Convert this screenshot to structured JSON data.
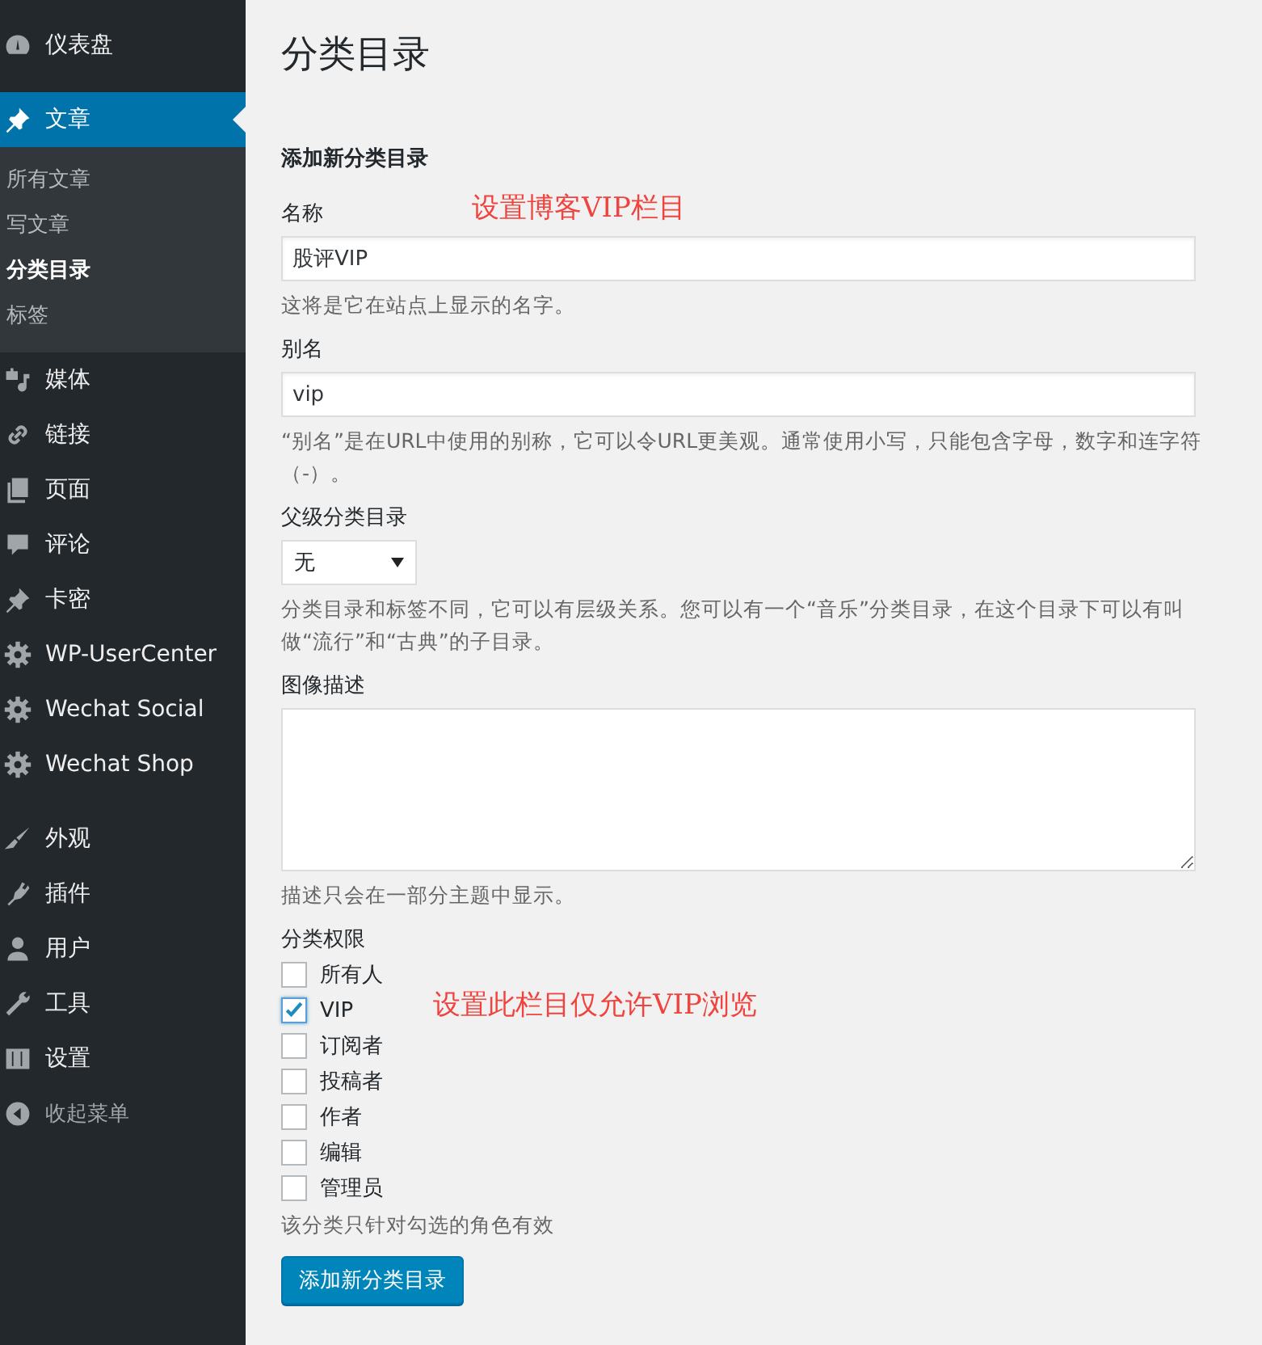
{
  "sidebar": {
    "items": [
      {
        "label": "仪表盘",
        "kind": "menu",
        "selected": false,
        "separator_after": true
      },
      {
        "label": "文章",
        "kind": "menu",
        "selected": true,
        "separator_after": false,
        "submenu": [
          {
            "label": "所有文章",
            "selected": false
          },
          {
            "label": "写文章",
            "selected": false
          },
          {
            "label": "分类目录",
            "selected": true
          },
          {
            "label": "标签",
            "selected": false
          }
        ]
      },
      {
        "label": "媒体",
        "kind": "menu",
        "selected": false,
        "separator_after": false
      },
      {
        "label": "链接",
        "kind": "menu",
        "selected": false,
        "separator_after": false
      },
      {
        "label": "页面",
        "kind": "menu",
        "selected": false,
        "separator_after": false
      },
      {
        "label": "评论",
        "kind": "menu",
        "selected": false,
        "separator_after": false
      },
      {
        "label": "卡密",
        "kind": "menu",
        "selected": false,
        "separator_after": false
      },
      {
        "label": "WP-UserCenter",
        "kind": "menu",
        "selected": false,
        "separator_after": false
      },
      {
        "label": "Wechat Social",
        "kind": "menu",
        "selected": false,
        "separator_after": false
      },
      {
        "label": "Wechat Shop",
        "kind": "menu",
        "selected": false,
        "separator_after": true
      },
      {
        "label": "外观",
        "kind": "menu",
        "selected": false,
        "separator_after": false
      },
      {
        "label": "插件",
        "kind": "menu",
        "selected": false,
        "separator_after": false
      },
      {
        "label": "用户",
        "kind": "menu",
        "selected": false,
        "separator_after": false
      },
      {
        "label": "工具",
        "kind": "menu",
        "selected": false,
        "separator_after": false
      },
      {
        "label": "设置",
        "kind": "menu",
        "selected": false,
        "separator_after": false
      },
      {
        "label": "收起菜单",
        "kind": "collapse",
        "selected": false,
        "separator_after": false
      }
    ]
  },
  "page_title": "分类目录",
  "form": {
    "heading": "添加新分类目录",
    "fields": [
      {
        "kind": "text",
        "label": "名称",
        "value": "股评VIP",
        "help": "这将是它在站点上显示的名字。",
        "note": "设置博客VIP栏目"
      },
      {
        "kind": "text",
        "label": "别名",
        "value": "vip",
        "help": "“别名”是在URL中使用的别称，它可以令URL更美观。通常使用小写，只能包含字母，数字和连字符（-）。"
      },
      {
        "kind": "select",
        "label": "父级分类目录",
        "value": "无",
        "help": "分类目录和标签不同，它可以有层级关系。您可以有一个“音乐”分类目录，在这个目录下可以有叫做“流行”和“古典”的子目录。"
      },
      {
        "kind": "textarea",
        "label": "图像描述",
        "help": "描述只会在一部分主题中显示。"
      },
      {
        "kind": "checkboxes",
        "label": "分类权限",
        "note": "设置此栏目仅允许VIP浏览",
        "options": [
          {
            "label": "所有人",
            "checked": false
          },
          {
            "label": "VIP",
            "checked": true
          },
          {
            "label": "订阅者",
            "checked": false
          },
          {
            "label": "投稿者",
            "checked": false
          },
          {
            "label": "作者",
            "checked": false
          },
          {
            "label": "编辑",
            "checked": false
          },
          {
            "label": "管理员",
            "checked": false
          }
        ],
        "help": "该分类只针对勾选的角色有效"
      }
    ],
    "submit": "添加新分类目录"
  }
}
